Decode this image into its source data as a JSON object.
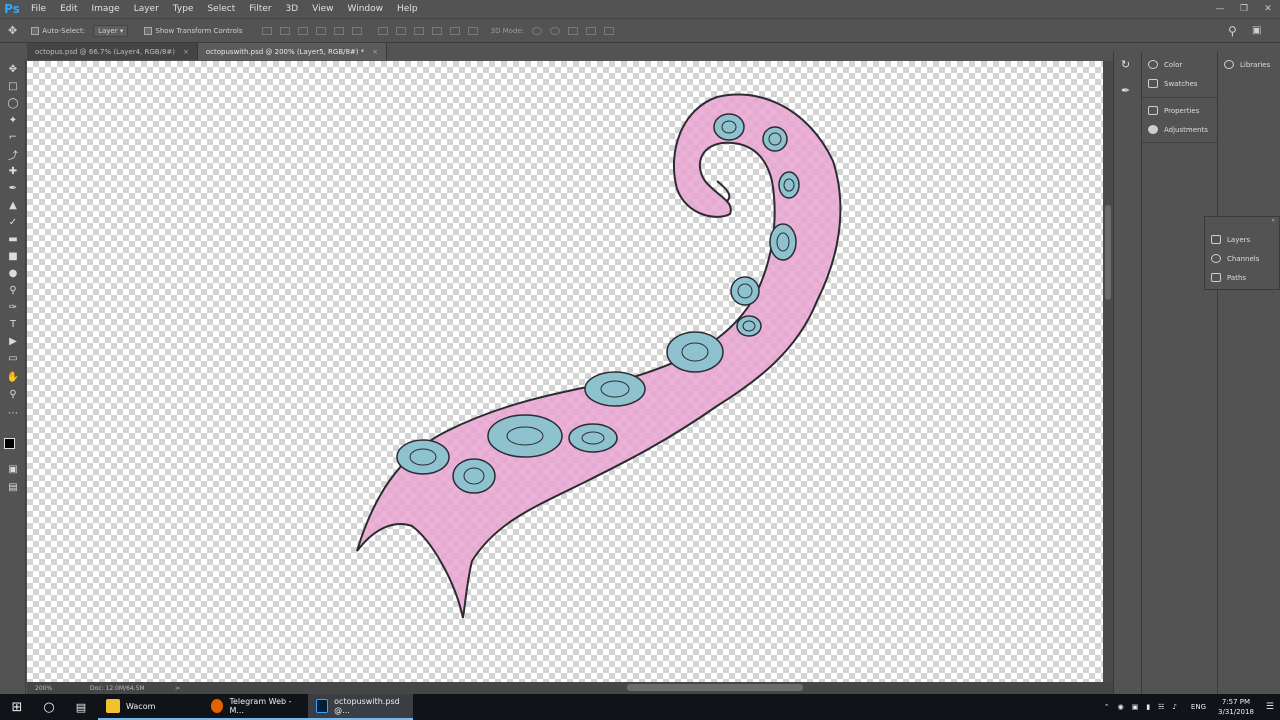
{
  "app": {
    "logo": "Ps"
  },
  "menu": [
    "File",
    "Edit",
    "Image",
    "Layer",
    "Type",
    "Select",
    "Filter",
    "3D",
    "View",
    "Window",
    "Help"
  ],
  "options_bar": {
    "auto_select_label": "Auto-Select:",
    "auto_select_value": "Layer",
    "transform_controls_label": "Show Transform Controls",
    "mode_3d_label": "3D Mode:"
  },
  "tabs": [
    {
      "label": "octopus.psd @ 66.7% (Layer4, RGB/8#)",
      "close": "×"
    },
    {
      "label": "octopuswith.psd @ 200% (Layer5, RGB/8#) *",
      "close": "×"
    }
  ],
  "status": {
    "zoom": "200%",
    "doc": "Doc: 12.0M/64.5M",
    "arrow": ">"
  },
  "panels": {
    "group1": [
      "Color",
      "Swatches"
    ],
    "group2": [
      "Properties",
      "Adjustments"
    ],
    "libraries": "Libraries",
    "float": [
      "Layers",
      "Channels",
      "Paths"
    ]
  },
  "taskbar": {
    "apps": [
      {
        "label": "Wacom",
        "color": "#f2c12e"
      },
      {
        "label": "Telegram Web - M...",
        "color": "#e66000"
      },
      {
        "label": "octopuswith.psd @...",
        "color": "#31a8ff"
      }
    ],
    "lang": "ENG",
    "time": "7:57 PM",
    "date": "3/31/2018"
  },
  "colors": {
    "tentacle": "#e9a3d0",
    "sucker": "#8fc2cf",
    "outline": "#2b2b33"
  }
}
